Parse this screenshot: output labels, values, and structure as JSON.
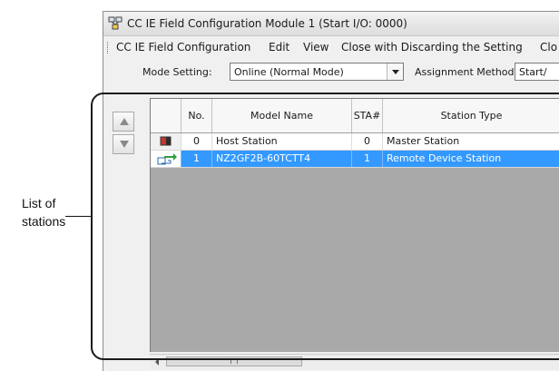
{
  "window": {
    "title": "CC IE Field Configuration Module 1 (Start I/O: 0000)"
  },
  "menu": [
    {
      "label": "CC IE Field Configuration"
    },
    {
      "label": "Edit"
    },
    {
      "label": "View"
    },
    {
      "label": "Close with Discarding the Setting"
    },
    {
      "label": "Clo"
    }
  ],
  "mode": {
    "label": "Mode Setting:",
    "value": "Online (Normal Mode)",
    "assignment_label": "Assignment Method:",
    "assignment_value": "Start/"
  },
  "table": {
    "columns": [
      "No.",
      "Model Name",
      "STA#",
      "Station Type"
    ],
    "rows": [
      {
        "icon": "master-station-icon",
        "no": "0",
        "model": "Host Station",
        "sta": "0",
        "type": "Master Station",
        "selected": false
      },
      {
        "icon": "remote-device-icon",
        "no": "1",
        "model": "NZ2GF2B-60TCTT4",
        "sta": "1",
        "type": "Remote Device Station",
        "selected": true
      }
    ]
  },
  "scrollbar": {
    "thumb_glyph": "III"
  },
  "callout": {
    "line1": "List of",
    "line2": "stations"
  },
  "colors": {
    "selection": "#3399ff",
    "grid_background": "#a9a9a9"
  }
}
